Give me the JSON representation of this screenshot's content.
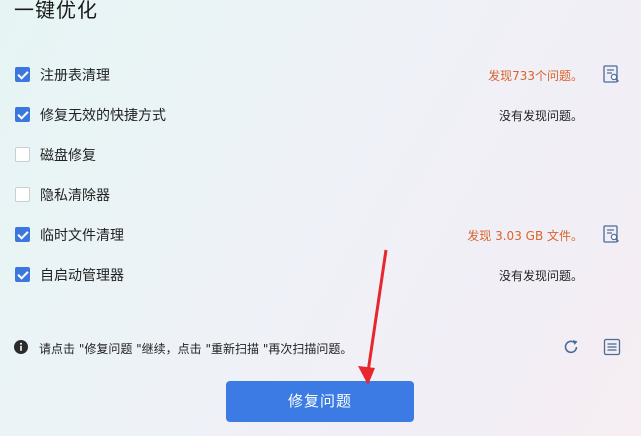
{
  "header": {
    "title": "一键优化"
  },
  "items": [
    {
      "label": "注册表清理",
      "checked": true,
      "status": "发现733个问题。",
      "status_color": "#d9632b",
      "has_detail_icon": true
    },
    {
      "label": "修复无效的快捷方式",
      "checked": true,
      "status": "没有发现问题。",
      "status_color": "#222222",
      "has_detail_icon": false
    },
    {
      "label": "磁盘修复",
      "checked": false,
      "status": "",
      "has_detail_icon": false
    },
    {
      "label": "隐私清除器",
      "checked": false,
      "status": "",
      "has_detail_icon": false
    },
    {
      "label": "临时文件清理",
      "checked": true,
      "status": "发现 3.03 GB 文件。",
      "status_color": "#d9632b",
      "has_detail_icon": true
    },
    {
      "label": "自启动管理器",
      "checked": true,
      "status": "没有发现问题。",
      "status_color": "#222222",
      "has_detail_icon": false
    }
  ],
  "footer": {
    "note": "请点击 \"修复问题 \"继续，点击 \"重新扫描 \"再次扫描问题。",
    "fix_button_label": "修复问题"
  },
  "colors": {
    "accent": "#3b7be3",
    "warning": "#d9632b",
    "arrow": "#e8262d"
  },
  "icons": [
    "detail-report-icon",
    "info-icon",
    "refresh-icon",
    "list-icon"
  ]
}
